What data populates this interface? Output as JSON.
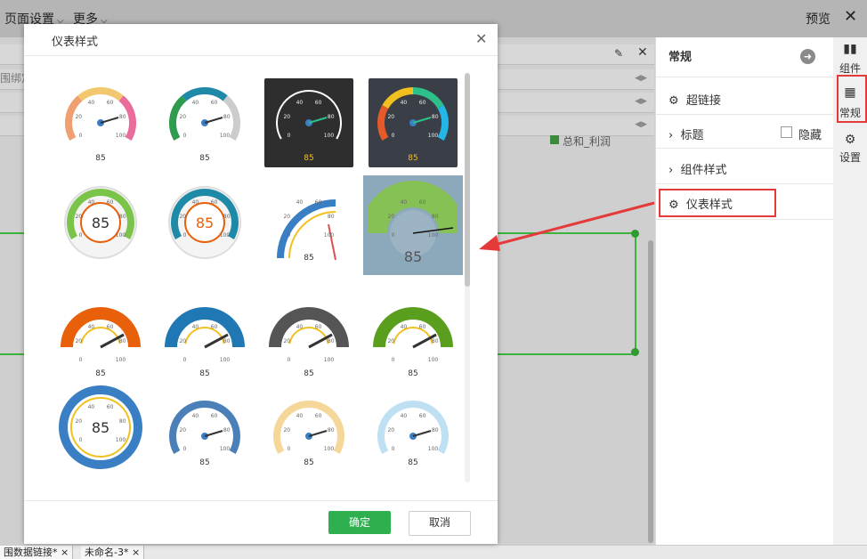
{
  "topbar": {
    "menu1": "页面设置",
    "menu2": "更多",
    "preview": "预览"
  },
  "canvas": {
    "binder_text": "围绑定",
    "legend_text": "总和_利润"
  },
  "right_panel": {
    "title": "常规",
    "items": {
      "hyperlink": "超链接",
      "title": "标题",
      "hide": "隐藏",
      "component_style": "组件样式",
      "gauge_style": "仪表样式"
    }
  },
  "side_tabs": {
    "components": "组件",
    "general": "常规",
    "settings": "设置"
  },
  "bottom_tabs": [
    "围数据链接*",
    "未命名-3*"
  ],
  "dialog": {
    "title": "仪表样式",
    "ok": "确定",
    "cancel": "取消",
    "gauge_value": "85",
    "tick_labels": [
      "0",
      "20",
      "40",
      "60",
      "80",
      "100"
    ]
  },
  "colors": {
    "accent_green": "#2eb04f",
    "highlight_red": "#e53a3a",
    "selected_bg": "#8ca9bc"
  }
}
